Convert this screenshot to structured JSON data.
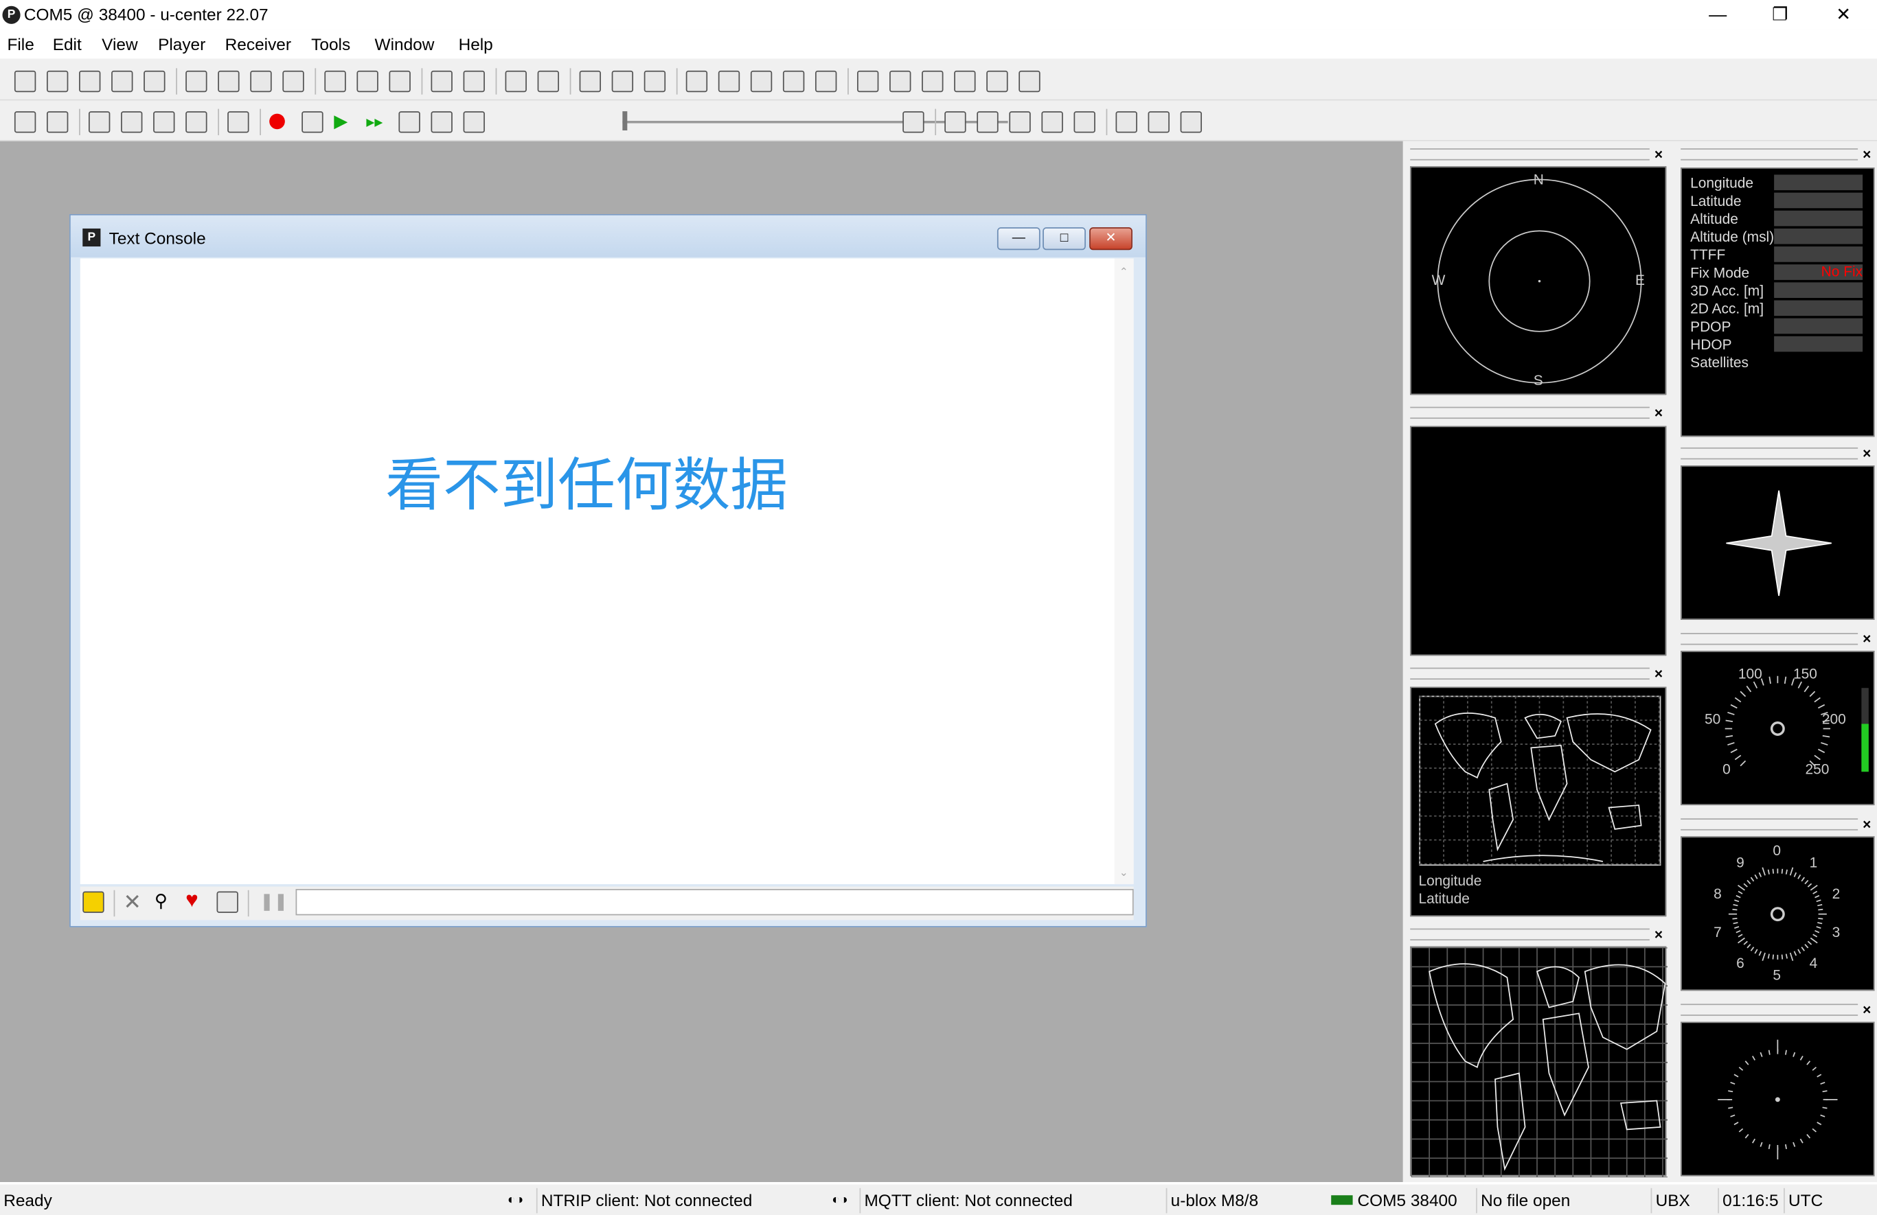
{
  "window": {
    "title": "COM5 @ 38400 - u-center 22.07",
    "app_icon": "P",
    "controls": [
      "minimize",
      "restore",
      "close"
    ]
  },
  "menu": [
    "File",
    "Edit",
    "View",
    "Player",
    "Receiver",
    "Tools",
    "Window",
    "Help"
  ],
  "toolbar1_icons": [
    "new-icon",
    "save-icon",
    "open-icon",
    "print-icon",
    "print-preview-icon",
    "cut-icon",
    "copy-icon",
    "paste-icon",
    "clear-icon",
    "doc1-icon",
    "doc2-icon",
    "doc3-icon",
    "view1-icon",
    "view2-icon",
    "sum-icon",
    "table-icon",
    "chart-icon",
    "graph-icon",
    "histogram-icon",
    "sky-icon",
    "radar-icon",
    "satellite-icon",
    "signal-icon",
    "level-icon",
    "world-icon",
    "list-icon",
    "compass-icon",
    "deviation-icon",
    "clock-icon",
    "status-icon"
  ],
  "toolbar2_icons": [
    "connection-icon",
    "baudrate-icon",
    "autobaud-icon",
    "debug-icon",
    "download-icon",
    "settings-icon",
    "eject-icon",
    "record-icon",
    "pause-icon",
    "play-icon",
    "fast-forward-icon",
    "step-back-icon",
    "step-forward-icon",
    "rewind-icon",
    "end-icon",
    "hot-start-icon",
    "warm-start-icon",
    "cold-start-icon",
    "msg-add-icon",
    "msg-add2-icon",
    "config1-icon",
    "config2-icon",
    "config3-icon"
  ],
  "console": {
    "title": "Text Console",
    "icon": "P",
    "message": "看不到任何数据",
    "toolbar_icons": [
      "lock-icon",
      "clear-icon",
      "filter-icon",
      "heart-icon",
      "save-log-icon",
      "pause-icon"
    ],
    "input_value": ""
  },
  "sky_view": {
    "labels": {
      "n": "N",
      "s": "S",
      "e": "E",
      "w": "W"
    }
  },
  "world_map": {
    "labels": [
      "Longitude",
      "Latitude"
    ]
  },
  "data_view": {
    "rows": [
      {
        "label": "Longitude",
        "value": ""
      },
      {
        "label": "Latitude",
        "value": ""
      },
      {
        "label": "Altitude",
        "value": ""
      },
      {
        "label": "Altitude (msl)",
        "value": ""
      },
      {
        "label": "TTFF",
        "value": ""
      },
      {
        "label": "Fix Mode",
        "value": "No Fix"
      },
      {
        "label": "3D Acc. [m]",
        "value": ""
      },
      {
        "label": "2D Acc. [m]",
        "value": ""
      },
      {
        "label": "PDOP",
        "value": ""
      },
      {
        "label": "HDOP",
        "value": ""
      },
      {
        "label": "Satellites",
        "value": null
      }
    ],
    "fix_color": "#ff0000"
  },
  "speedometer": {
    "ticks": [
      "0",
      "50",
      "100",
      "150",
      "200",
      "250"
    ],
    "value": 0
  },
  "clock": {
    "ticks": [
      "0",
      "1",
      "2",
      "3",
      "4",
      "5",
      "6",
      "7",
      "8",
      "9"
    ]
  },
  "status": {
    "ready": "Ready",
    "ntrip": "NTRIP client: Not connected",
    "mqtt": "MQTT client: Not connected",
    "receiver": "u-blox M8/8",
    "port": "COM5 38400",
    "file": "No file open",
    "protocol": "UBX",
    "time": "01:16:5",
    "tz": "UTC"
  }
}
